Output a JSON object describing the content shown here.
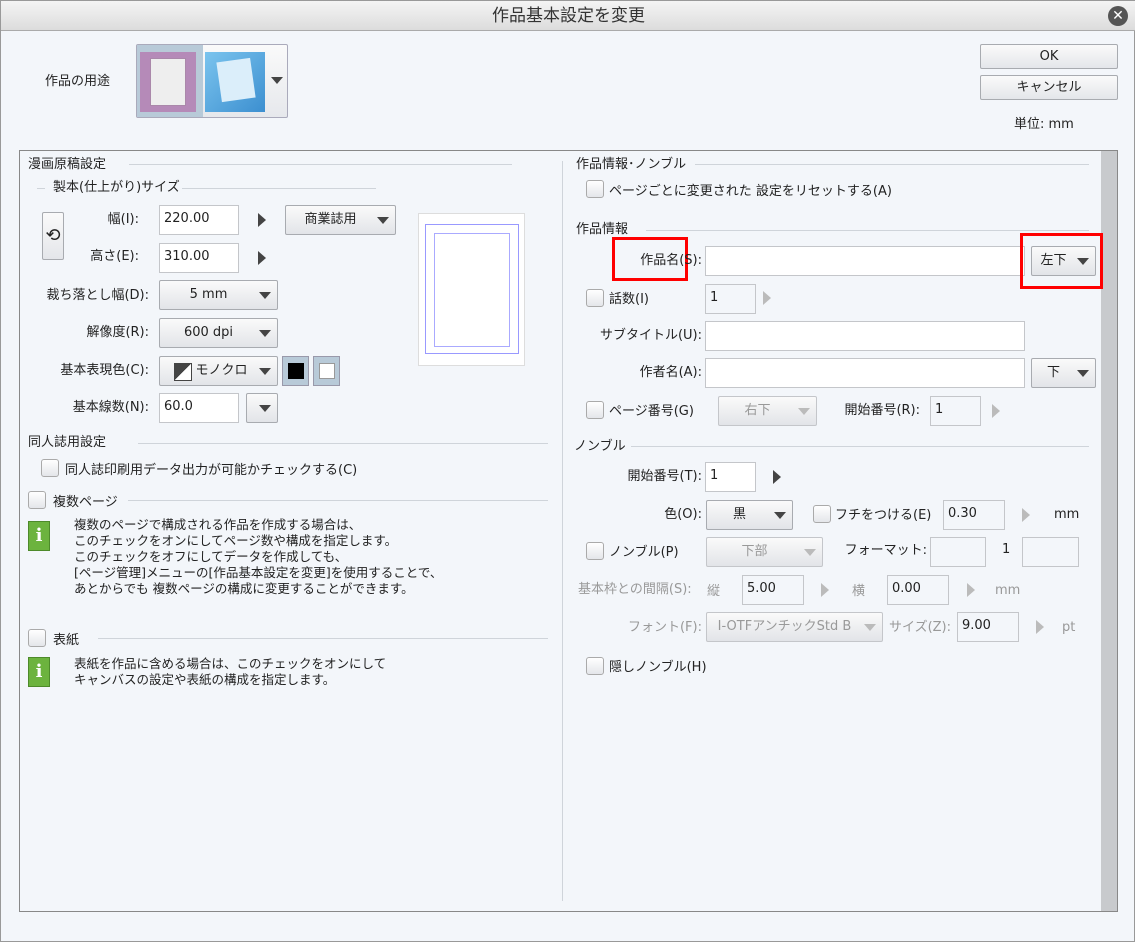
{
  "title": "作品基本設定を変更",
  "buttons": {
    "ok": "OK",
    "cancel": "キャンセル"
  },
  "unit": "単位:  mm",
  "purpose": {
    "label": "作品の用途"
  },
  "left": {
    "section": "漫画原稿設定",
    "subsection": "製本(仕上がり)サイズ",
    "width_label": "幅(I):",
    "width_value": "220.00",
    "height_label": "高さ(E):",
    "height_value": "310.00",
    "preset": "商業誌用",
    "bleed_label": "裁ち落とし幅(D):",
    "bleed_value": "5 mm",
    "resolution_label": "解像度(R):",
    "resolution_value": "600 dpi",
    "color_label": "基本表現色(C):",
    "color_value": "モノクロ",
    "lpi_label": "基本線数(N):",
    "lpi_value": "60.0",
    "doujin_section": "同人誌用設定",
    "doujin_check": "同人誌印刷用データ出力が可能かチェックする(C)",
    "multi_page": "複数ページ",
    "multi_info": [
      "複数のページで構成される作品を作成する場合は、",
      "このチェックをオンにしてページ数や構成を指定します。",
      "このチェックをオフにしてデータを作成しても、",
      "[ページ管理]メニューの[作品基本設定を変更]を使用することで、",
      "あとからでも 複数ページの構成に変更することができます。"
    ],
    "cover": "表紙",
    "cover_info": [
      "表紙を作品に含める場合は、このチェックをオンにして",
      "キャンバスの設定や表紙の構成を指定します。"
    ]
  },
  "right": {
    "section": "作品情報･ノンブル",
    "reset_check": "ページごとに変更された 設定をリセットする(A)",
    "info_section": "作品情報",
    "title_label": "作品名(S):",
    "title_value": "",
    "title_pos": "左下",
    "episode_label": "話数(I)",
    "episode_value": "1",
    "subtitle_label": "サブタイトル(U):",
    "subtitle_value": "",
    "author_label": "作者名(A):",
    "author_value": "",
    "author_pos": "下",
    "pagenum_label": "ページ番号(G)",
    "pagenum_pos": "右下",
    "start_label": "開始番号(R):",
    "start_value": "1",
    "nombre_section": "ノンブル",
    "n_start_label": "開始番号(T):",
    "n_start_value": "1",
    "color_label": "色(O):",
    "color_value": "黒",
    "border_label": "フチをつける(E)",
    "border_value": "0.30",
    "border_unit": "mm",
    "nombre_label": "ノンブル(P)",
    "nombre_pos": "下部",
    "format_label": "フォーマット:",
    "format_mid": "1",
    "gap_label": "基本枠との間隔(S):",
    "v_label": "縦",
    "v_value": "5.00",
    "h_label": "横",
    "h_value": "0.00",
    "gap_unit": "mm",
    "font_label": "フォント(F):",
    "font_value": "I-OTFアンチックStd B",
    "size_label": "サイズ(Z):",
    "size_value": "9.00",
    "size_unit": "pt",
    "hidden_label": "隠しノンブル(H)"
  }
}
